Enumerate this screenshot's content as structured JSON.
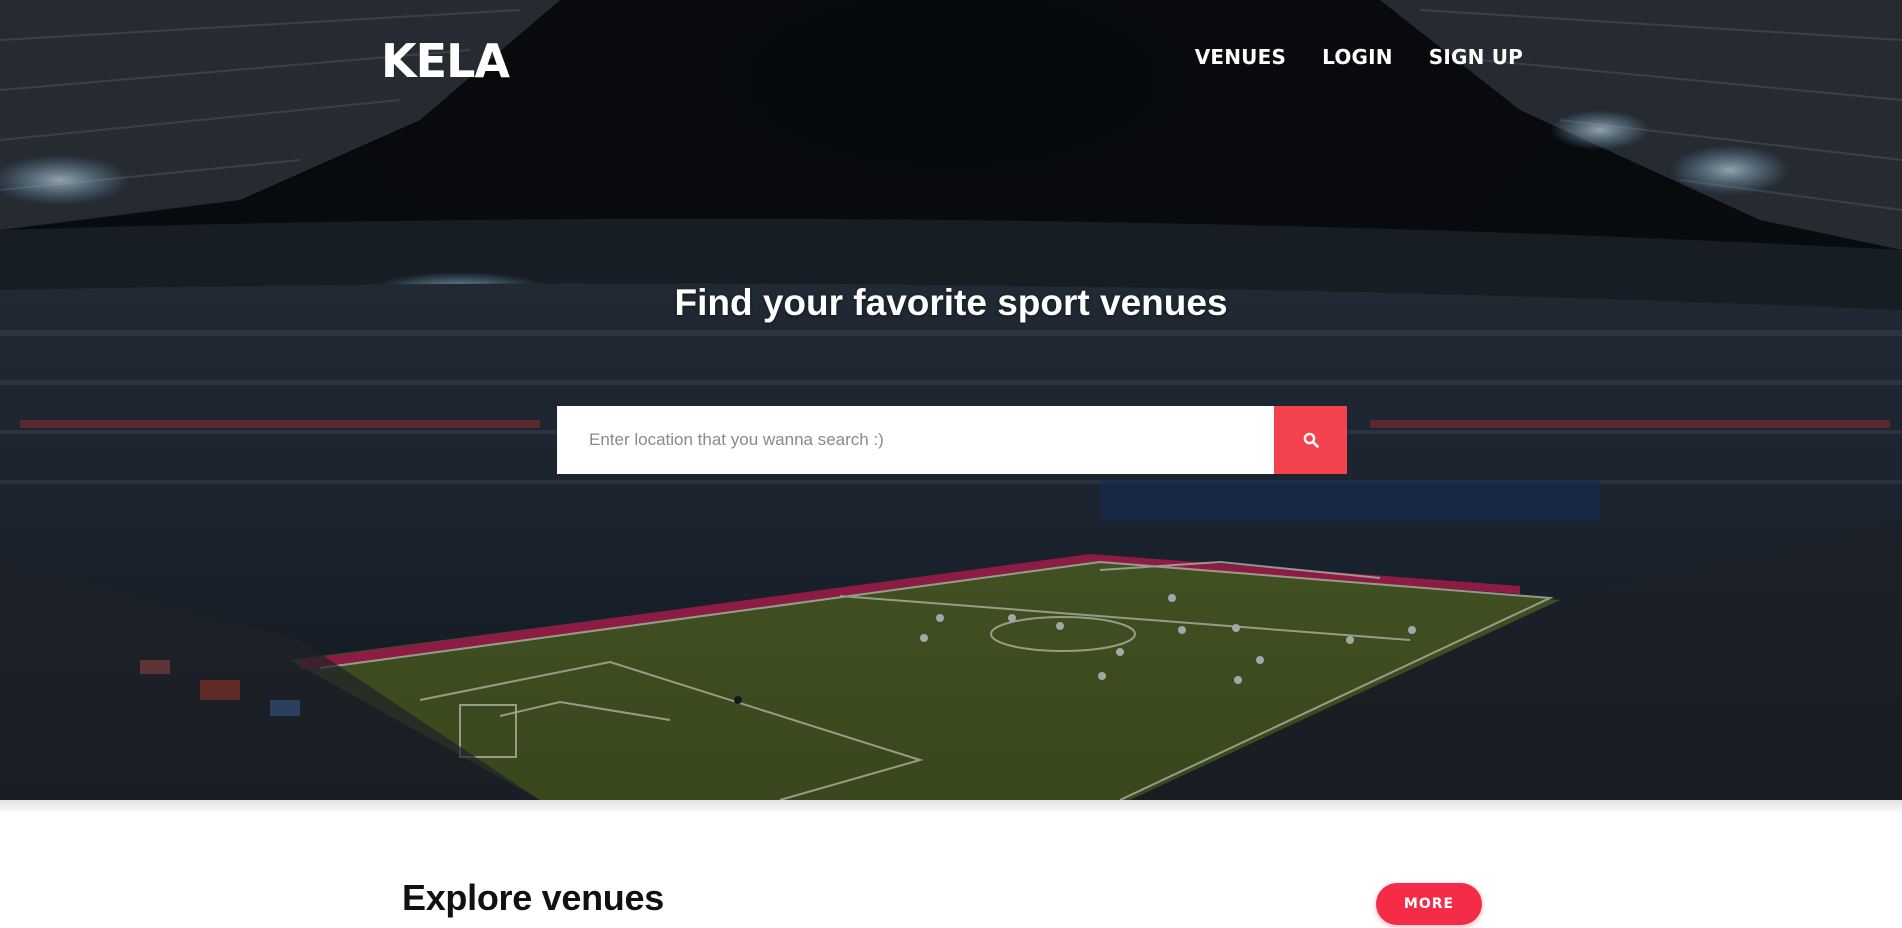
{
  "brand": {
    "name": "KELA"
  },
  "nav": {
    "venues": "VENUES",
    "login": "LOGIN",
    "signup": "SIGN UP"
  },
  "hero": {
    "headline": "Find your favorite sport venues",
    "background": "stadium-photo"
  },
  "search": {
    "placeholder": "Enter location that you wanna search :)",
    "value": "",
    "icon": "search-icon"
  },
  "explore": {
    "title": "Explore venues",
    "more_label": "MORE"
  },
  "colors": {
    "accent": "#f4434f",
    "more_button": "#f42c48",
    "text_dark": "#111111"
  }
}
